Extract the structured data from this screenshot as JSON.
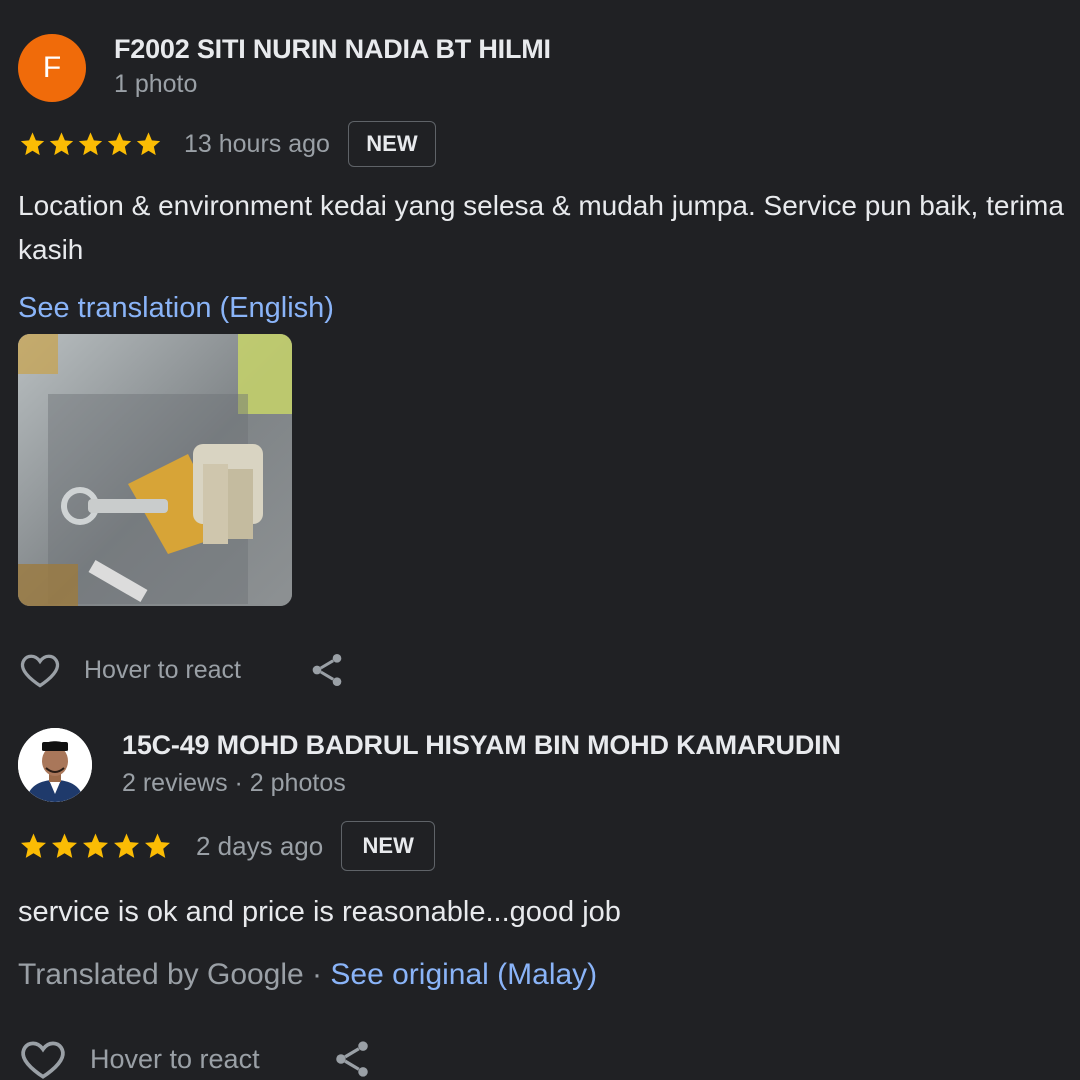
{
  "reviews": [
    {
      "author": {
        "name": "F2002 SITI NURIN NADIA BT HILMI",
        "meta": "1 photo",
        "avatar_letter": "F",
        "avatar_color": "#f06b0a"
      },
      "rating": 5,
      "time_ago": "13 hours ago",
      "badge": "NEW",
      "text": "Location & environment kedai yang selesa & mudah jumpa. Service pun baik, terima kasih",
      "translation_link": "See translation (English)",
      "photo_icon": "keys-photo",
      "react_label": "Hover to react"
    },
    {
      "author": {
        "name": "15C-49 MOHD BADRUL HISYAM BIN MOHD KAMARUDIN",
        "meta": "2 reviews · 2 photos",
        "avatar_icon": "profile-photo"
      },
      "rating": 5,
      "time_ago": "2 days ago",
      "badge": "NEW",
      "text": "service is ok and price is reasonable...good job",
      "translated_by": "Translated by Google · ",
      "original_link": "See original (Malay)",
      "react_label": "Hover to react"
    }
  ],
  "colors": {
    "background": "#202124",
    "star": "#fbbc04",
    "link": "#8ab4f8",
    "text": "#e8eaed",
    "muted": "#9aa0a6"
  }
}
